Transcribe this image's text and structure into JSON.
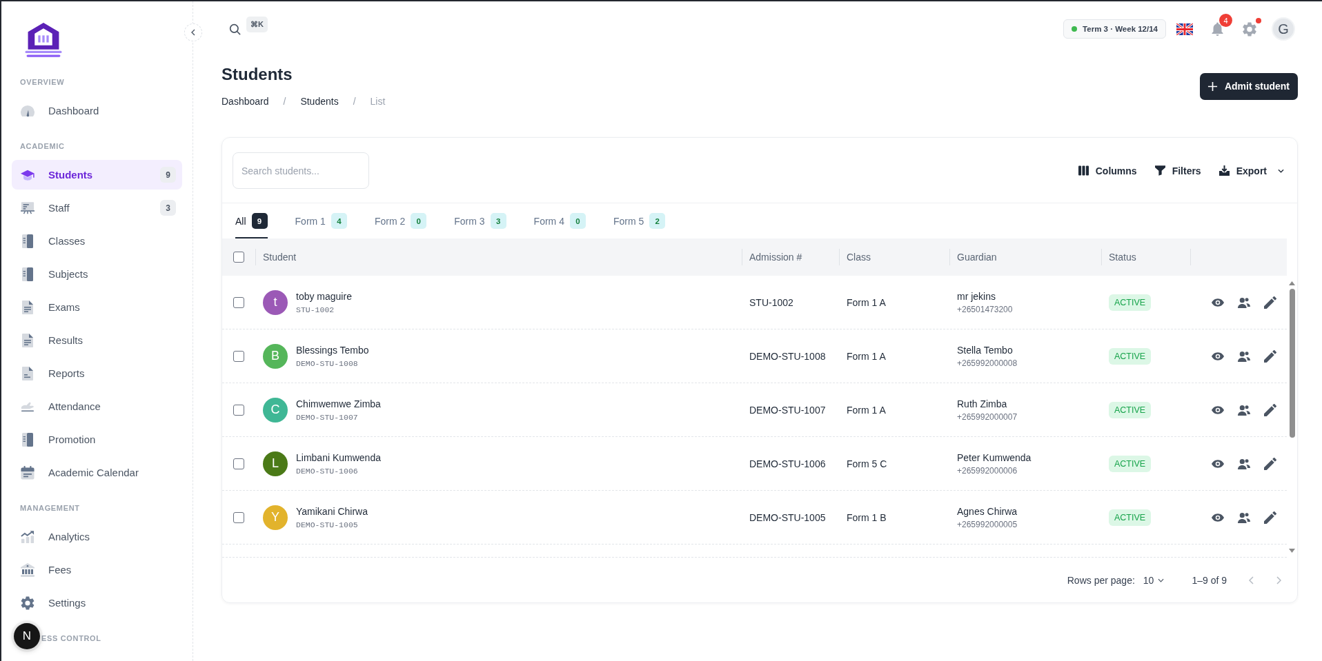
{
  "sidebar": {
    "sections": [
      {
        "title": "OVERVIEW",
        "items": [
          {
            "label": "Dashboard",
            "selected": false
          }
        ]
      },
      {
        "title": "ACADEMIC",
        "items": [
          {
            "label": "Students",
            "selected": true,
            "badge": "9"
          },
          {
            "label": "Staff",
            "selected": false,
            "badge": "3"
          },
          {
            "label": "Classes",
            "selected": false
          },
          {
            "label": "Subjects",
            "selected": false
          },
          {
            "label": "Exams",
            "selected": false
          },
          {
            "label": "Results",
            "selected": false
          },
          {
            "label": "Reports",
            "selected": false
          },
          {
            "label": "Attendance",
            "selected": false
          },
          {
            "label": "Promotion",
            "selected": false
          },
          {
            "label": "Academic Calendar",
            "selected": false
          }
        ]
      },
      {
        "title": "MANAGEMENT",
        "items": [
          {
            "label": "Analytics",
            "selected": false
          },
          {
            "label": "Fees",
            "selected": false
          },
          {
            "label": "Settings",
            "selected": false
          }
        ]
      },
      {
        "title": "ESS CONTROL"
      }
    ]
  },
  "dev_button": {
    "label": "N"
  },
  "topbar": {
    "shortcut": "⌘K",
    "term": "Term 3 · Week 12/14",
    "notification_count": "4",
    "settings_alert": true,
    "avatar": "G"
  },
  "page": {
    "title": "Students",
    "breadcrumb": [
      {
        "kind": "link",
        "label": "Dashboard"
      },
      {
        "kind": "separator",
        "label": "/"
      },
      {
        "kind": "link",
        "label": "Students"
      },
      {
        "kind": "separator",
        "label": "/"
      },
      {
        "kind": "current",
        "label": "List"
      }
    ],
    "primary_action": "Admit student"
  },
  "students_card": {
    "search": {
      "placeholder": "Search students..."
    },
    "toolbar": [
      {
        "label": "Columns",
        "dropdown": false
      },
      {
        "label": "Filters",
        "dropdown": false
      },
      {
        "label": "Export",
        "dropdown": true
      }
    ],
    "tabs": [
      {
        "label": "All",
        "count": "9",
        "selected": true
      },
      {
        "label": "Form 1",
        "count": "4",
        "selected": false
      },
      {
        "label": "Form 2",
        "count": "0",
        "selected": false
      },
      {
        "label": "Form 3",
        "count": "3",
        "selected": false
      },
      {
        "label": "Form 4",
        "count": "0",
        "selected": false
      },
      {
        "label": "Form 5",
        "count": "2",
        "selected": false
      }
    ],
    "table": {
      "select_all_checked": false,
      "columns": [
        "Student",
        "Admission #",
        "Class",
        "Guardian",
        "Status"
      ],
      "rows": [
        {
          "checked": false,
          "initial": "t",
          "color": "#9b59b6",
          "name": "toby maguire",
          "student_id": "STU-1002",
          "admission_no": "STU-1002",
          "class": "Form 1 A",
          "guardian": "mr jekins",
          "guardian_phone": "+26501473200",
          "status": "ACTIVE"
        },
        {
          "checked": false,
          "initial": "B",
          "color": "#55b65a",
          "name": "Blessings Tembo",
          "student_id": "DEMO-STU-1008",
          "admission_no": "DEMO-STU-1008",
          "class": "Form 1 A",
          "guardian": "Stella Tembo",
          "guardian_phone": "+265992000008",
          "status": "ACTIVE"
        },
        {
          "checked": false,
          "initial": "C",
          "color": "#3fb795",
          "name": "Chimwemwe Zimba",
          "student_id": "DEMO-STU-1007",
          "admission_no": "DEMO-STU-1007",
          "class": "Form 1 A",
          "guardian": "Ruth Zimba",
          "guardian_phone": "+265992000007",
          "status": "ACTIVE"
        },
        {
          "checked": false,
          "initial": "L",
          "color": "#4b7a17",
          "name": "Limbani Kumwenda",
          "student_id": "DEMO-STU-1006",
          "admission_no": "DEMO-STU-1006",
          "class": "Form 5 C",
          "guardian": "Peter Kumwenda",
          "guardian_phone": "+265992000006",
          "status": "ACTIVE"
        },
        {
          "checked": false,
          "initial": "Y",
          "color": "#e2b32c",
          "name": "Yamikani Chirwa",
          "student_id": "DEMO-STU-1005",
          "admission_no": "DEMO-STU-1005",
          "class": "Form 1 B",
          "guardian": "Agnes Chirwa",
          "guardian_phone": "+265992000005",
          "status": "ACTIVE"
        }
      ]
    },
    "pagination": {
      "rows_per_page_label": "Rows per page:",
      "rows_per_page": "10",
      "range": "1–9 of 9",
      "previous_disabled": true,
      "next_disabled": true
    }
  }
}
